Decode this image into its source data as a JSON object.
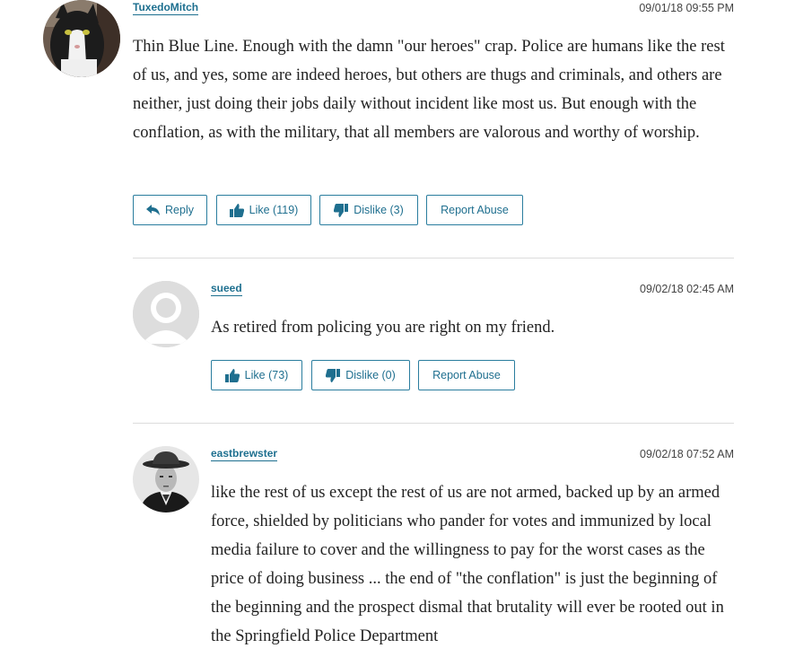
{
  "comments": [
    {
      "username": "TuxedoMitch",
      "timestamp": "09/01/18 09:55 PM",
      "text": "Thin Blue Line. Enough with the damn \"our heroes\" crap. Police are humans like the rest of us, and yes, some are indeed heroes, but others are thugs and criminals, and others are neither, just doing their jobs daily without incident like most us. But enough with the conflation, as with the military, that all members are valorous and worthy of worship.",
      "reply_label": "Reply",
      "like_label": "Like (119)",
      "dislike_label": "Dislike (3)",
      "report_label": "Report Abuse",
      "avatar": "cat-photo"
    },
    {
      "username": "sueed",
      "timestamp": "09/02/18 02:45 AM",
      "text": "As retired from policing you are right on my friend.",
      "like_label": "Like (73)",
      "dislike_label": "Dislike (0)",
      "report_label": "Report Abuse",
      "avatar": "default-user-silhouette"
    },
    {
      "username": "eastbrewster",
      "timestamp": "09/02/18 07:52 AM",
      "text": "like the rest of us except the rest of us are not armed, backed up by an armed force, shielded by politicians who pander for votes and immunized by local media failure to cover and the willingness to pay for the worst cases as the price of doing business ... the end of \"the conflation\" is just the beginning of the beginning and the prospect dismal that brutality will ever be rooted out in the Springfield Police Department",
      "avatar": "man-in-hat-photo"
    }
  ],
  "colors": {
    "accent": "#1f6f8f",
    "divider": "#dcdcdc",
    "text": "#222222"
  },
  "icons": {
    "reply": "reply-arrow-icon",
    "like": "thumbs-up-icon",
    "dislike": "thumbs-down-icon"
  }
}
